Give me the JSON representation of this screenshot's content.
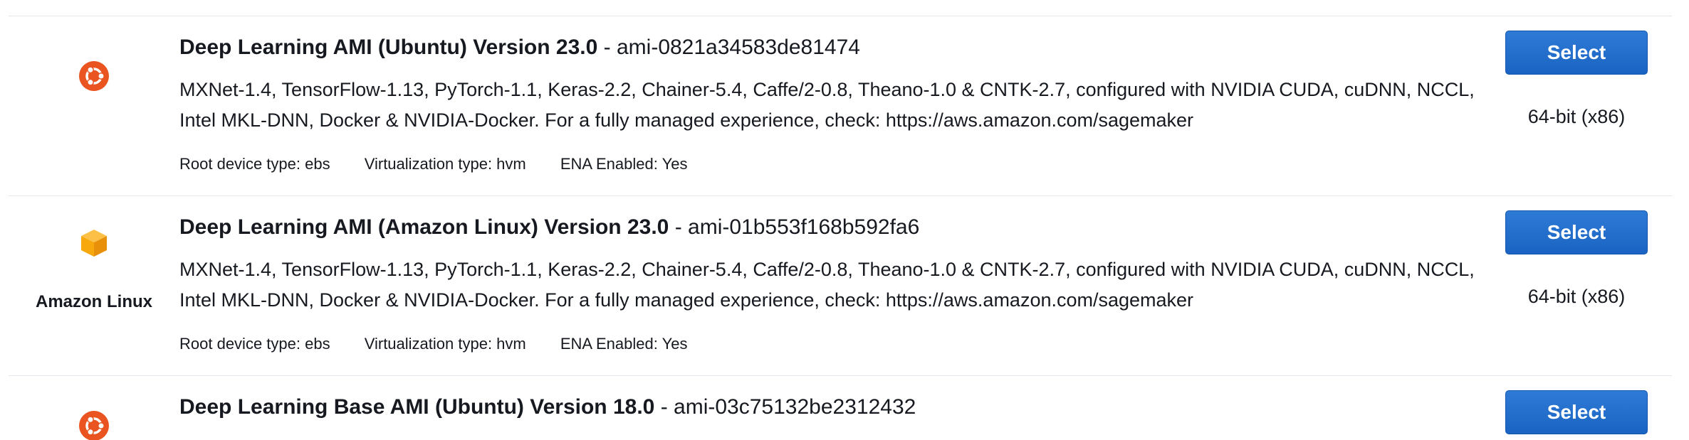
{
  "amis": [
    {
      "os_icon": "ubuntu-icon",
      "os_label": "",
      "name": "Deep Learning AMI (Ubuntu) Version 23.0",
      "ami_id": "ami-0821a34583de81474",
      "description": "MXNet-1.4, TensorFlow-1.13, PyTorch-1.1, Keras-2.2, Chainer-5.4, Caffe/2-0.8, Theano-1.0 & CNTK-2.7, configured with NVIDIA CUDA, cuDNN, NCCL, Intel MKL-DNN, Docker & NVIDIA-Docker. For a fully managed experience, check: https://aws.amazon.com/sagemaker",
      "root_device": "Root device type: ebs",
      "virtualization": "Virtualization type: hvm",
      "ena": "ENA Enabled: Yes",
      "select_label": "Select",
      "arch": "64-bit (x86)"
    },
    {
      "os_icon": "amazon-linux-icon",
      "os_label": "Amazon Linux",
      "name": "Deep Learning AMI (Amazon Linux) Version 23.0",
      "ami_id": "ami-01b553f168b592fa6",
      "description": "MXNet-1.4, TensorFlow-1.13, PyTorch-1.1, Keras-2.2, Chainer-5.4, Caffe/2-0.8, Theano-1.0 & CNTK-2.7, configured with NVIDIA CUDA, cuDNN, NCCL, Intel MKL-DNN, Docker & NVIDIA-Docker. For a fully managed experience, check: https://aws.amazon.com/sagemaker",
      "root_device": "Root device type: ebs",
      "virtualization": "Virtualization type: hvm",
      "ena": "ENA Enabled: Yes",
      "select_label": "Select",
      "arch": "64-bit (x86)"
    },
    {
      "os_icon": "ubuntu-icon",
      "os_label": "",
      "name": "Deep Learning Base AMI (Ubuntu) Version 18.0",
      "ami_id": "ami-03c75132be2312432",
      "description": "",
      "root_device": "",
      "virtualization": "",
      "ena": "",
      "select_label": "Select",
      "arch": ""
    }
  ],
  "colors": {
    "select_button": "#1a63c2",
    "ubuntu_orange": "#e95420",
    "amazon_orange": "#f7a80d",
    "divider": "#e4e7eb"
  }
}
